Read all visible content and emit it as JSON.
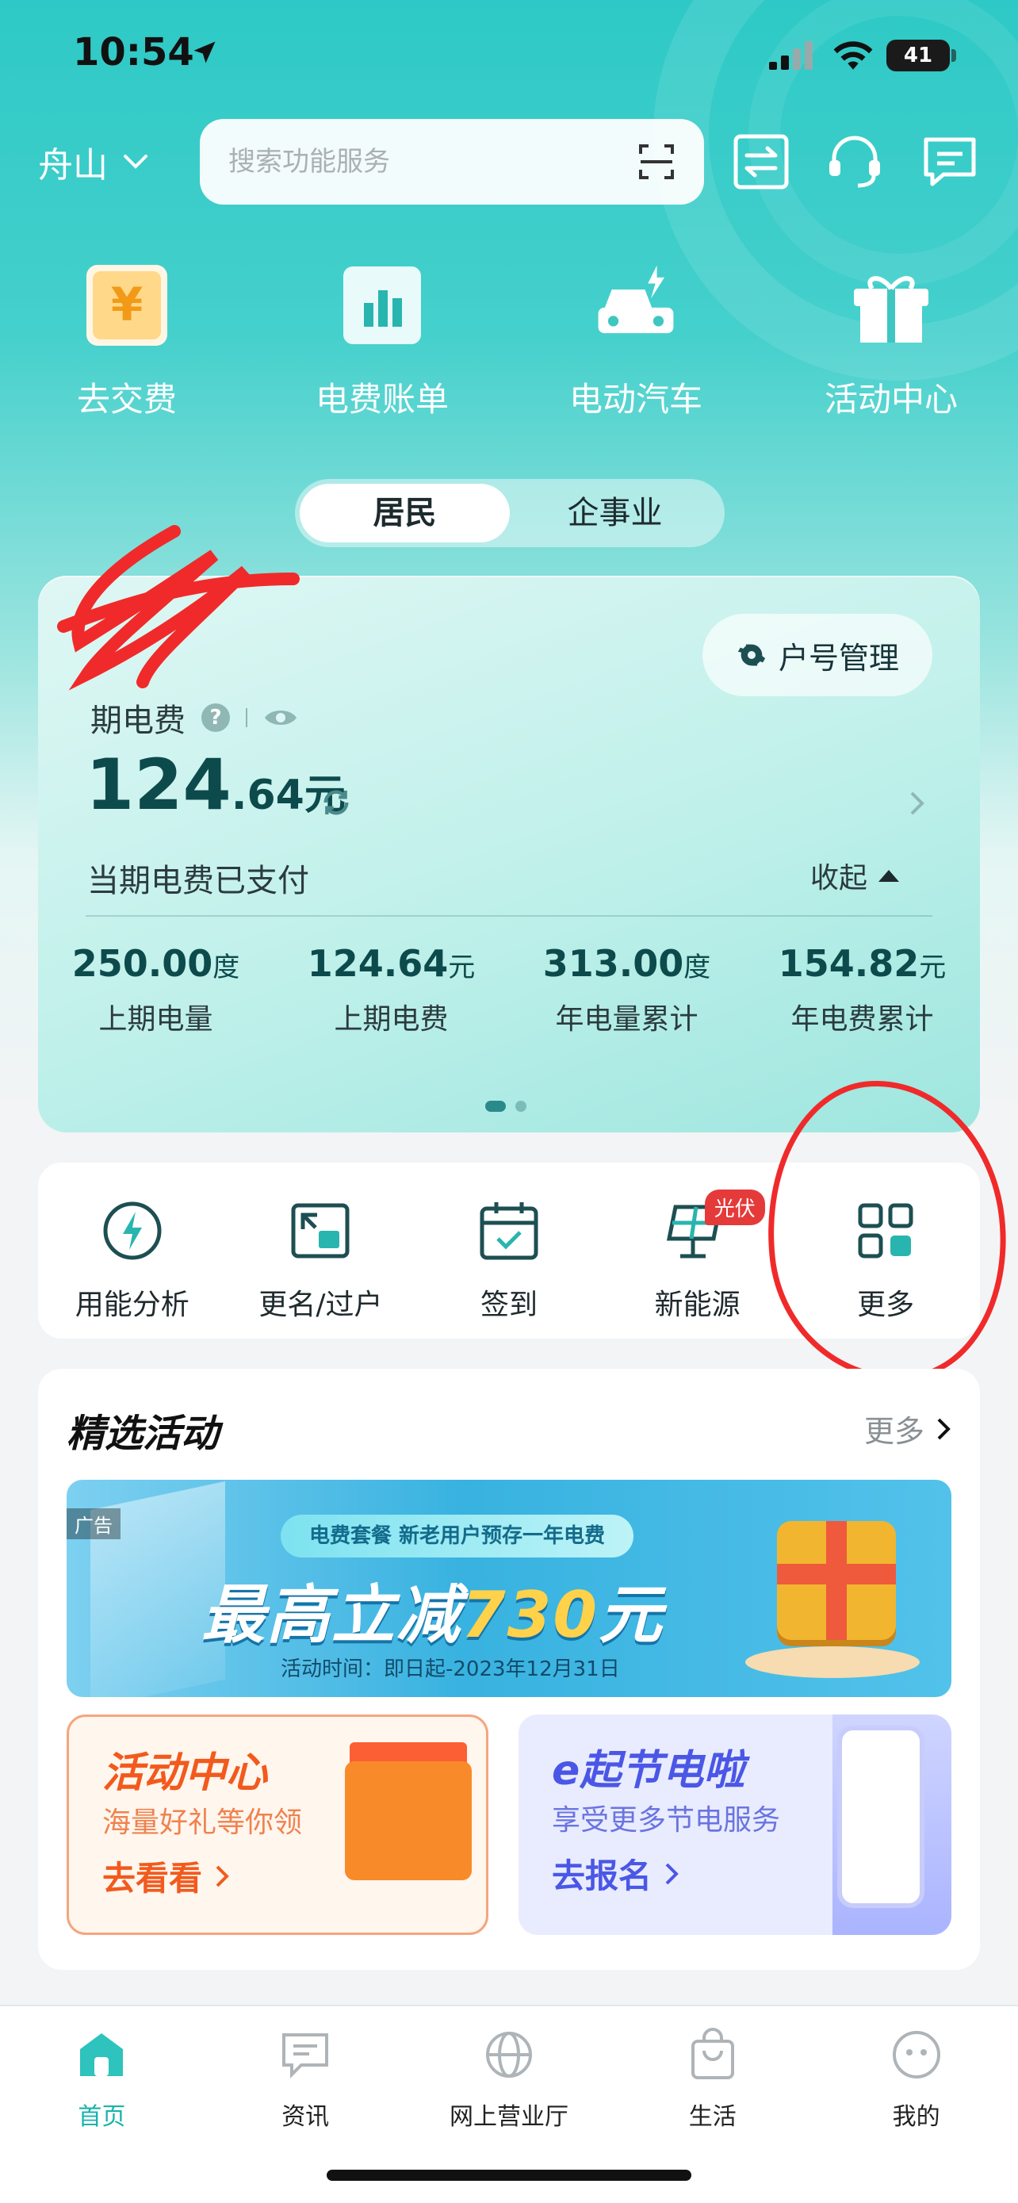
{
  "status_bar": {
    "time": "10:54",
    "battery": "41"
  },
  "header": {
    "city": "舟山",
    "search_placeholder": "搜索功能服务",
    "icons": [
      "scan-icon",
      "exchange-icon",
      "customer-service-icon",
      "message-icon"
    ]
  },
  "quick_actions": [
    {
      "label": "去交费",
      "icon": "yuan-icon"
    },
    {
      "label": "电费账单",
      "icon": "bar-chart-icon"
    },
    {
      "label": "电动汽车",
      "icon": "ev-car-icon"
    },
    {
      "label": "活动中心",
      "icon": "gift-icon"
    }
  ],
  "segment": {
    "options": [
      "居民",
      "企事业"
    ],
    "selected": "居民"
  },
  "bill_card": {
    "account_btn": "户号管理",
    "current_label": "期电费",
    "amount_int": "124",
    "amount_dec": ".64",
    "amount_unit": "元",
    "paid_text": "当期电费已支付",
    "collapse": "收起",
    "stats": [
      {
        "value": "250.00",
        "unit": "度",
        "label": "上期电量"
      },
      {
        "value": "124.64",
        "unit": "元",
        "label": "上期电费"
      },
      {
        "value": "313.00",
        "unit": "度",
        "label": "年电量累计"
      },
      {
        "value": "154.82",
        "unit": "元",
        "label": "年电费累计"
      }
    ],
    "page_dots": {
      "count": 2,
      "active": 1
    }
  },
  "services": [
    {
      "label": "用能分析",
      "icon": "lightning-circle-icon"
    },
    {
      "label": "更名/过户",
      "icon": "transfer-icon"
    },
    {
      "label": "签到",
      "icon": "calendar-check-icon"
    },
    {
      "label": "新能源",
      "icon": "solar-panel-icon",
      "badge": "光伏"
    },
    {
      "label": "更多",
      "icon": "grid-more-icon"
    }
  ],
  "activities": {
    "title": "精选活动",
    "more": "更多",
    "banner": {
      "ad_tag": "广告",
      "pill": "电费套餐  新老用户预存一年电费",
      "headline_prefix": "最高立减",
      "headline_num": "730",
      "headline_suffix": "元",
      "period": "活动时间：即日起-2023年12月31日"
    },
    "promos": [
      {
        "title": "活动中心",
        "subtitle": "海量好礼等你领",
        "cta": "去看看"
      },
      {
        "title": "e起节电啦",
        "subtitle": "享受更多节电服务",
        "cta": "去报名"
      }
    ]
  },
  "tabbar": [
    {
      "label": "首页",
      "icon": "home-icon",
      "active": true
    },
    {
      "label": "资讯",
      "icon": "news-icon",
      "active": false
    },
    {
      "label": "网上营业厅",
      "icon": "globe-icon",
      "active": false
    },
    {
      "label": "生活",
      "icon": "shopping-bag-icon",
      "active": false
    },
    {
      "label": "我的",
      "icon": "profile-icon",
      "active": false
    }
  ],
  "colors": {
    "brand": "#19b3ad",
    "deep_teal": "#0d4a4c",
    "annotation_red": "#f02a2a"
  }
}
